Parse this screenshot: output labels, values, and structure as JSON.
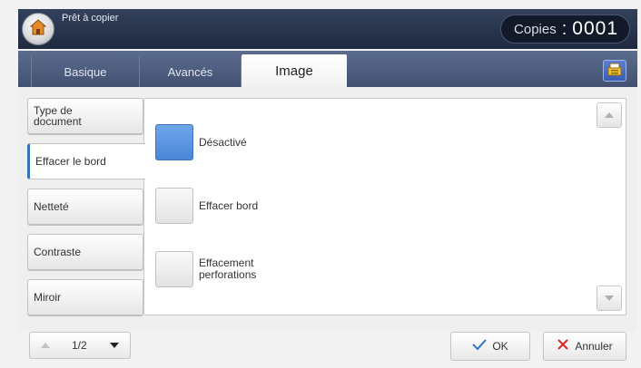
{
  "header": {
    "status": "Prêt à copier",
    "copies_label": "Copies",
    "copies_separator": ":",
    "copies_value": "0001",
    "home_icon": "home-icon"
  },
  "tabs": [
    {
      "label": "Basique",
      "active": false
    },
    {
      "label": "Avancés",
      "active": false
    },
    {
      "label": "Image",
      "active": true
    }
  ],
  "job_icon": "job-status-icon",
  "sidebar": {
    "items": [
      {
        "label": "Type de document",
        "active": false
      },
      {
        "label": "Effacer le bord",
        "active": true
      },
      {
        "label": "Netteté",
        "active": false
      },
      {
        "label": "Contraste",
        "active": false
      },
      {
        "label": "Miroir",
        "active": false
      }
    ]
  },
  "options": [
    {
      "label": "Désactivé",
      "selected": true
    },
    {
      "label": "Effacer bord",
      "selected": false
    },
    {
      "label": "Effacement perforations",
      "selected": false
    }
  ],
  "pager": {
    "text": "1/2"
  },
  "footer": {
    "ok_label": "OK",
    "cancel_label": "Annuler"
  },
  "colors": {
    "accent": "#4a86d8",
    "header": "#1f2a40",
    "tabbar": "#425171",
    "cancel_x": "#e02020",
    "ok_check": "#2f74c9"
  }
}
